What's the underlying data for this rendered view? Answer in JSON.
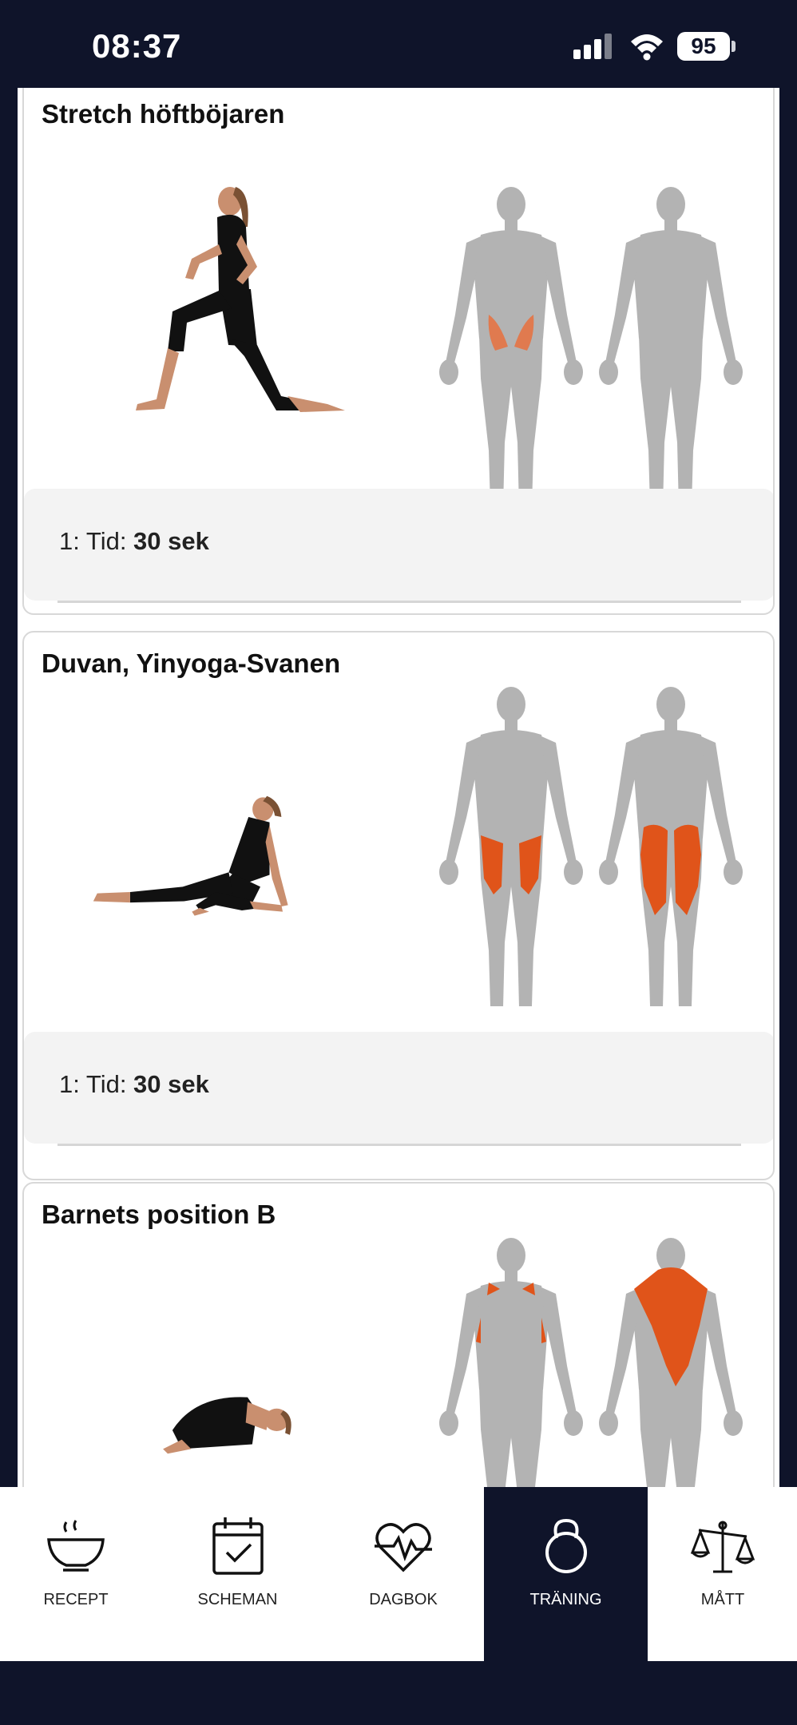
{
  "status": {
    "time": "08:37",
    "battery": "95"
  },
  "exercises": [
    {
      "title": "Stretch höftböjaren",
      "set_prefix": "1: Tid: ",
      "set_value": "30 sek"
    },
    {
      "title": "Duvan, Yinyoga-Svanen",
      "set_prefix": "1: Tid: ",
      "set_value": "30 sek"
    },
    {
      "title": "Barnets position B"
    }
  ],
  "tabs": [
    {
      "label": "RECEPT",
      "icon": "bowl-icon"
    },
    {
      "label": "SCHEMAN",
      "icon": "calendar-check-icon"
    },
    {
      "label": "DAGBOK",
      "icon": "heartbeat-icon"
    },
    {
      "label": "TRÄNING",
      "icon": "kettlebell-icon",
      "active": true
    },
    {
      "label": "MÅTT",
      "icon": "scale-icon"
    }
  ],
  "colors": {
    "background": "#0f142a",
    "accent": "#e0541a",
    "body_gray": "#b3b3b3"
  }
}
